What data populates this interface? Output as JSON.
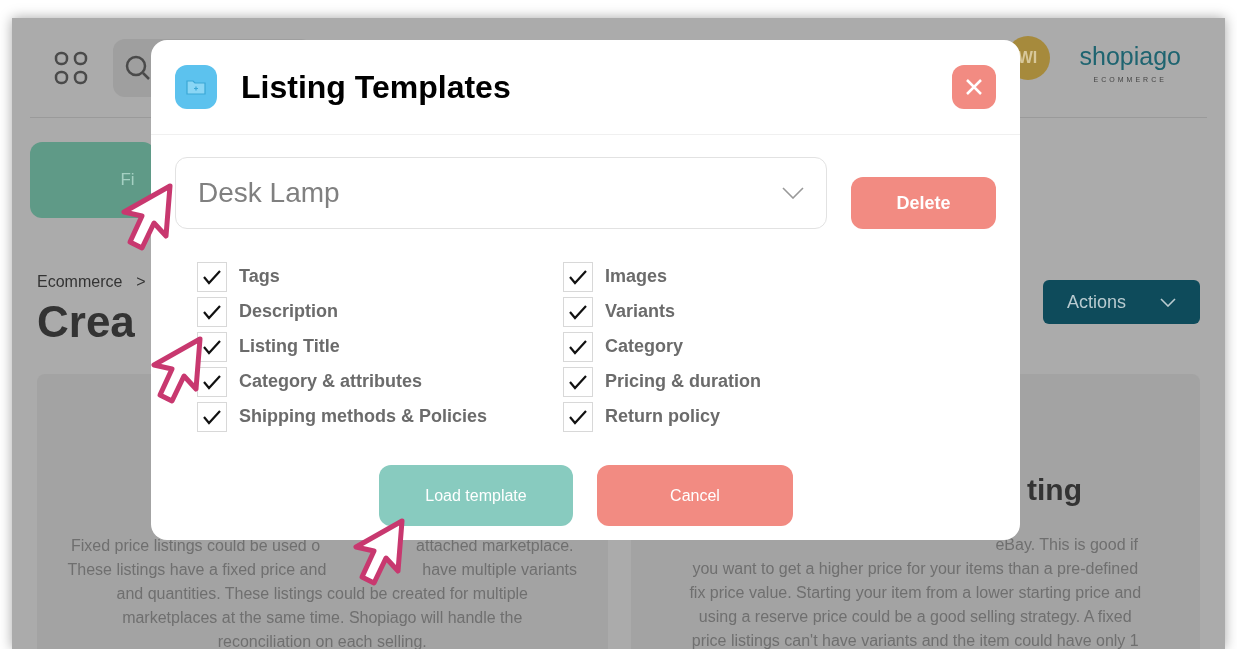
{
  "header": {
    "avatar": "WI",
    "logo": {
      "name": "shopiago",
      "tagline": "ECOMMERCE"
    }
  },
  "primary_button": "Fi",
  "breadcrumb": [
    "Ecommerce",
    ">"
  ],
  "page_title": "Crea",
  "actions_button": "Actions",
  "left_card": {
    "lines": [
      [
        "Fixed price listings could be used o",
        "attached marketplace."
      ],
      [
        "These listings have a fixed price and",
        "have multiple variants"
      ],
      [
        "and quantities. These listings could be created for multiple"
      ],
      [
        "marketplaces at the same time. Shopiago will handle the"
      ],
      [
        "reconciliation on each selling."
      ]
    ]
  },
  "right_card": {
    "title": "ting",
    "lines": [
      [
        "eBay. This is good if"
      ],
      [
        "you want to get a higher price for your items than a pre-defined"
      ],
      [
        "fix price value. Starting your item from a lower starting price and"
      ],
      [
        "using a reserve price could be a good selling strategy. A fixed"
      ],
      [
        "price listings can't have variants and the item could have only 1"
      ]
    ]
  },
  "modal": {
    "title": "Listing Templates",
    "template_select": {
      "value": "Desk Lamp"
    },
    "delete_button": "Delete",
    "options": [
      {
        "label": "Tags",
        "checked": true
      },
      {
        "label": "Description",
        "checked": true
      },
      {
        "label": "Listing Title",
        "checked": true
      },
      {
        "label": "Category & attributes",
        "checked": true
      },
      {
        "label": "Shipping methods & Policies",
        "checked": true
      },
      {
        "label": "Images",
        "checked": true
      },
      {
        "label": "Variants",
        "checked": true
      },
      {
        "label": "Category",
        "checked": true
      },
      {
        "label": "Pricing & duration",
        "checked": true
      },
      {
        "label": "Return policy",
        "checked": true
      }
    ],
    "load_button": "Load template",
    "cancel_button": "Cancel"
  }
}
